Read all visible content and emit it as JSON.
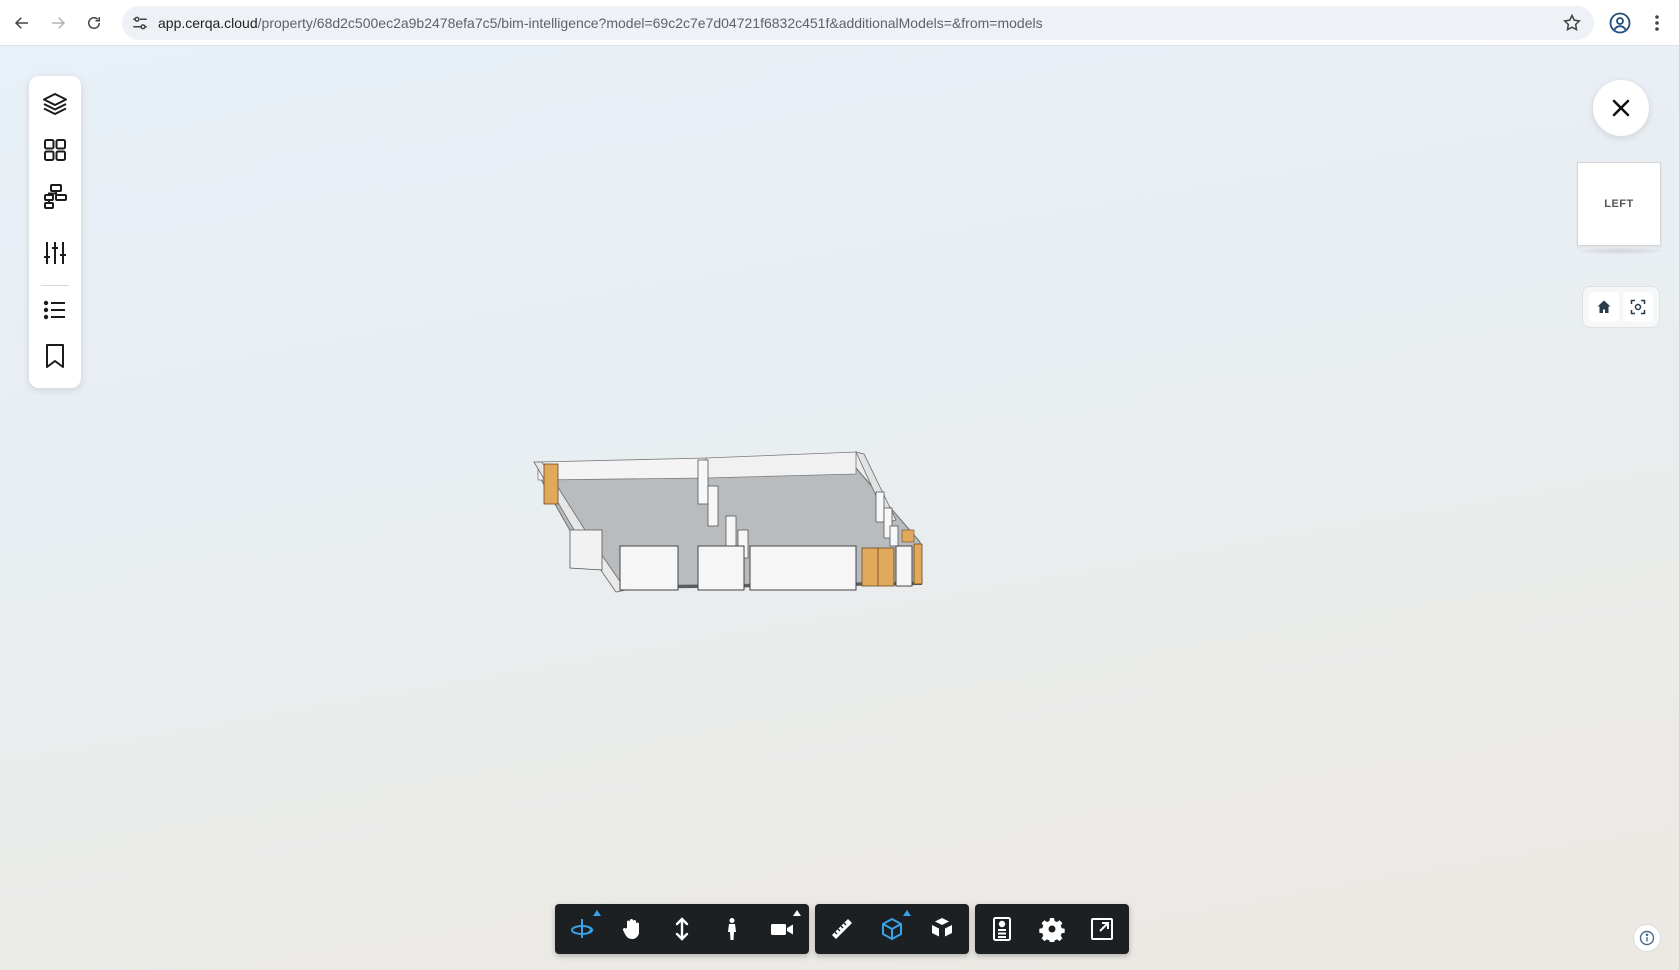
{
  "browser": {
    "url_host": "app.cerqa.cloud",
    "url_path": "/property/68d2c500ec2a9b2478efa7c5/bim-intelligence?model=69c2c7e7d04721f6832c451f&additionalModels=&from=models",
    "icons": {
      "back": "arrow-left-icon",
      "forward": "arrow-right-icon",
      "reload": "reload-icon",
      "site_info": "tune-icon",
      "bookmark": "star-icon",
      "profile": "account-circle-icon",
      "menu": "kebab-menu-icon"
    }
  },
  "viewer": {
    "left_toolbar": [
      {
        "id": "model-browser",
        "icon": "layers-icon"
      },
      {
        "id": "model-grid",
        "icon": "grid-icon"
      },
      {
        "id": "structure-tree",
        "icon": "hierarchy-icon"
      },
      {
        "id": "filters",
        "icon": "sliders-icon"
      },
      {
        "id": "list",
        "icon": "list-icon"
      },
      {
        "id": "bookmarks",
        "icon": "bookmark-icon"
      }
    ],
    "close_icon": "close-icon",
    "viewcube": {
      "face_label": "LEFT"
    },
    "camera_buttons": [
      {
        "id": "home",
        "icon": "home-icon"
      },
      {
        "id": "fit",
        "icon": "focus-icon"
      }
    ],
    "bottom_toolbar": {
      "groups": [
        [
          {
            "id": "orbit",
            "icon": "orbit-icon",
            "active": true,
            "flyout": true
          },
          {
            "id": "pan",
            "icon": "hand-icon",
            "active": false,
            "flyout": false
          },
          {
            "id": "zoom",
            "icon": "vertical-arrows-icon",
            "active": false,
            "flyout": false
          },
          {
            "id": "first-person",
            "icon": "person-icon",
            "active": false,
            "flyout": false
          },
          {
            "id": "camera",
            "icon": "video-camera-icon",
            "active": false,
            "flyout": true
          }
        ],
        [
          {
            "id": "measure",
            "icon": "ruler-icon",
            "active": false,
            "flyout": false
          },
          {
            "id": "section",
            "icon": "cube-icon",
            "active": true,
            "flyout": true
          },
          {
            "id": "explode",
            "icon": "explode-cubes-icon",
            "active": false,
            "flyout": false
          }
        ],
        [
          {
            "id": "properties",
            "icon": "properties-panel-icon",
            "active": false,
            "flyout": false
          },
          {
            "id": "settings",
            "icon": "gear-icon",
            "active": false,
            "flyout": false
          },
          {
            "id": "fullscreen",
            "icon": "fullscreen-icon",
            "active": false,
            "flyout": false
          }
        ]
      ]
    },
    "info_icon": "info-icon",
    "colors": {
      "toolbar_bg": "#1d2023",
      "active_tool": "#38a3e8",
      "door_wood": "#e0a95b"
    }
  }
}
